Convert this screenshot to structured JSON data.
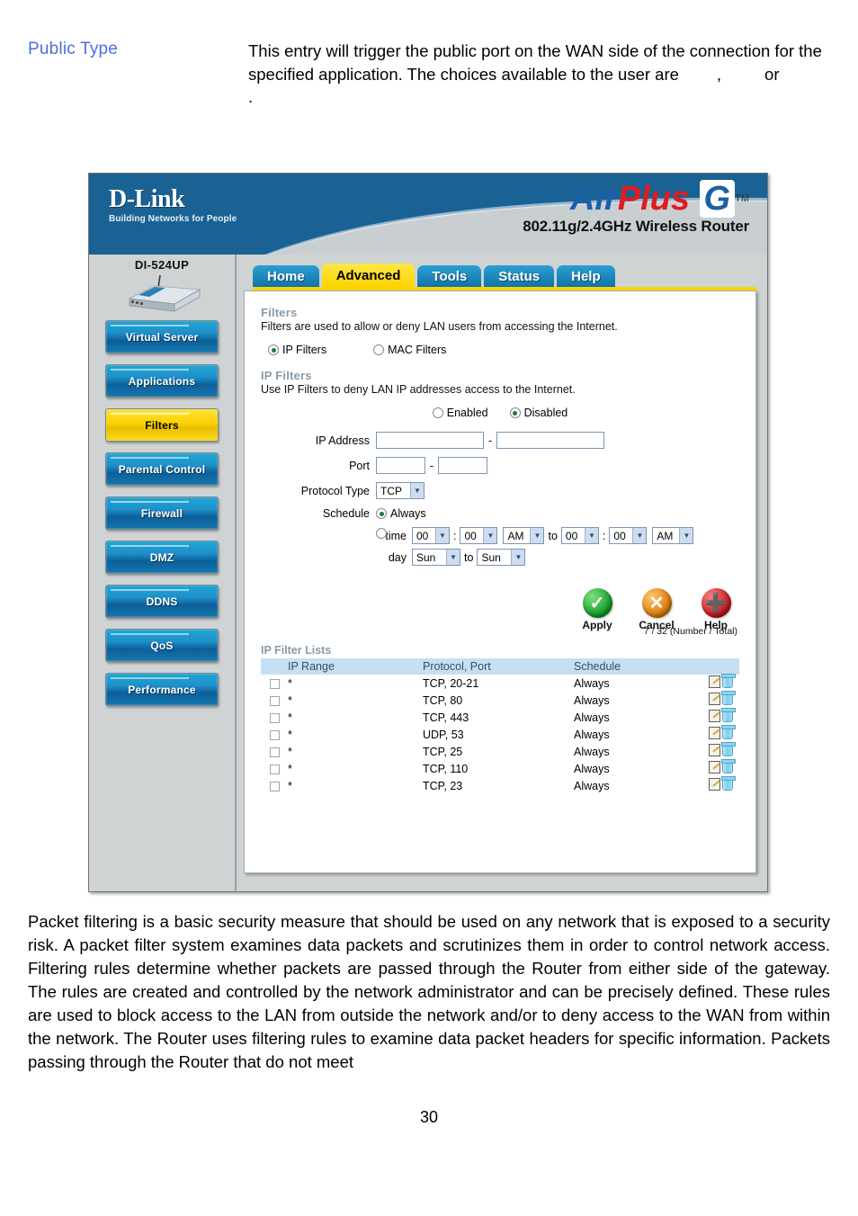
{
  "definition": {
    "term": "Public Type",
    "body_part1": "This entry will trigger the public port on the WAN side of the connection for the specified application. The choices available to the user are",
    "comma": ",",
    "or": "or",
    "period": "."
  },
  "router_ui": {
    "brand": {
      "name": "D-Link",
      "tagline": "Building Networks for People",
      "product_air": "Air",
      "product_plus": "Plus",
      "product_g": "G",
      "trademark": "TM",
      "product_subtitle": "802.11g/2.4GHz Wireless Router"
    },
    "sidebar": {
      "model": "DI-524UP",
      "items": [
        {
          "label": "Virtual Server",
          "active": false
        },
        {
          "label": "Applications",
          "active": false
        },
        {
          "label": "Filters",
          "active": true
        },
        {
          "label": "Parental Control",
          "active": false
        },
        {
          "label": "Firewall",
          "active": false
        },
        {
          "label": "DMZ",
          "active": false
        },
        {
          "label": "DDNS",
          "active": false
        },
        {
          "label": "QoS",
          "active": false
        },
        {
          "label": "Performance",
          "active": false
        }
      ]
    },
    "tabs": [
      {
        "label": "Home",
        "active": false
      },
      {
        "label": "Advanced",
        "active": true
      },
      {
        "label": "Tools",
        "active": false
      },
      {
        "label": "Status",
        "active": false
      },
      {
        "label": "Help",
        "active": false
      }
    ],
    "filters_section": {
      "heading": "Filters",
      "description": "Filters are used to allow or deny LAN users from accessing the Internet.",
      "type_options": [
        {
          "label": "IP Filters",
          "selected": true
        },
        {
          "label": "MAC Filters",
          "selected": false
        }
      ]
    },
    "ip_filters_section": {
      "heading": "IP Filters",
      "description": "Use IP Filters to deny LAN IP addresses access to the Internet.",
      "state_options": [
        {
          "label": "Enabled",
          "selected": false
        },
        {
          "label": "Disabled",
          "selected": true
        }
      ],
      "ip_address_label": "IP Address",
      "ip_address_start": "",
      "ip_address_end": "",
      "port_label": "Port",
      "port_start": "",
      "port_end": "",
      "protocol_label": "Protocol Type",
      "protocol_value": "TCP",
      "schedule_label": "Schedule",
      "schedule_always_label": "Always",
      "schedule_always_selected": true,
      "schedule_custom_selected": false,
      "time_label": "time",
      "time_from_hour": "00",
      "time_from_minute": "00",
      "time_from_meridiem": "AM",
      "time_to_word": "to",
      "time_to_hour": "00",
      "time_to_minute": "00",
      "time_to_meridiem": "AM",
      "day_label": "day",
      "day_from": "Sun",
      "day_to_word": "to",
      "day_to": "Sun",
      "colon": ":",
      "dash": "-"
    },
    "actions": [
      {
        "label": "Apply",
        "icon": "check-icon"
      },
      {
        "label": "Cancel",
        "icon": "close-icon"
      },
      {
        "label": "Help",
        "icon": "plus-icon"
      }
    ],
    "filter_list": {
      "title": "IP Filter Lists",
      "count_text": "7 / 32 (Number / Total)",
      "columns": [
        "",
        "IP Range",
        "Protocol, Port",
        "Schedule",
        ""
      ],
      "rows": [
        {
          "checked": false,
          "ip_range": "*",
          "protocol_port": "TCP, 20-21",
          "schedule": "Always"
        },
        {
          "checked": false,
          "ip_range": "*",
          "protocol_port": "TCP, 80",
          "schedule": "Always"
        },
        {
          "checked": false,
          "ip_range": "*",
          "protocol_port": "TCP, 443",
          "schedule": "Always"
        },
        {
          "checked": false,
          "ip_range": "*",
          "protocol_port": "UDP, 53",
          "schedule": "Always"
        },
        {
          "checked": false,
          "ip_range": "*",
          "protocol_port": "TCP, 25",
          "schedule": "Always"
        },
        {
          "checked": false,
          "ip_range": "*",
          "protocol_port": "TCP, 110",
          "schedule": "Always"
        },
        {
          "checked": false,
          "ip_range": "*",
          "protocol_port": "TCP, 23",
          "schedule": "Always"
        }
      ]
    }
  },
  "body_paragraph": "Packet filtering is a basic security measure that should be used on any network that is exposed to a security risk. A packet filter system examines data packets and scrutinizes them in order to control network access. Filtering rules determine whether packets are passed through the Router from either side of the gateway. The rules are created and controlled by the network administrator and can be precisely defined. These rules are used to block access to the LAN from outside the network and/or to deny access to the WAN from within the network. The Router uses filtering rules to examine data packet headers for specific information. Packets passing through the Router that do not meet",
  "page_number": "30"
}
